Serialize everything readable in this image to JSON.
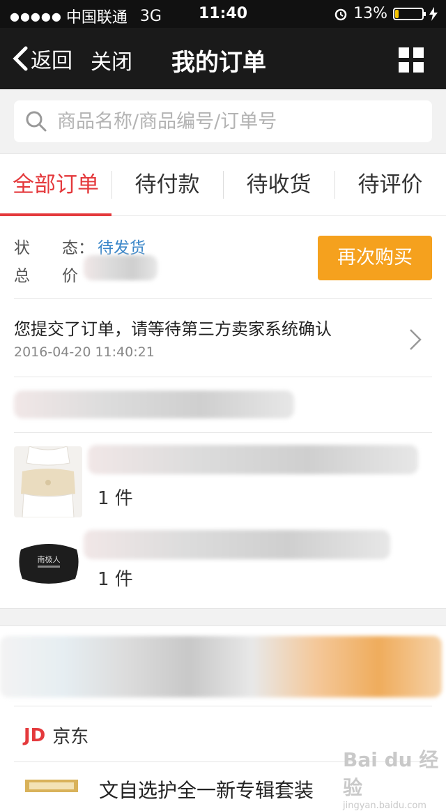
{
  "status_bar": {
    "carrier": "中国联通",
    "network": "3G",
    "time": "11:40",
    "battery_percent": "13%",
    "battery_level": 0.13,
    "battery_color": "#f5c400"
  },
  "nav": {
    "back_label": "返回",
    "close_label": "关闭",
    "title": "我的订单",
    "menu_icon": "grid-icon"
  },
  "search": {
    "placeholder": "商品名称/商品编号/订单号",
    "icon": "search-icon"
  },
  "tabs": [
    {
      "label": "全部订单",
      "active": true
    },
    {
      "label": "待付款",
      "active": false
    },
    {
      "label": "待收货",
      "active": false
    },
    {
      "label": "待评价",
      "active": false
    }
  ],
  "order": {
    "status_label": "状　　态：",
    "status_value": "待发货",
    "total_label": "总　　价",
    "rebuy_label": "再次购买",
    "tracking_message": "您提交了订单，请等待第三方卖家系统确认",
    "tracking_time": "2016-04-20 11:40:21",
    "items": [
      {
        "quantity": "1 件"
      },
      {
        "quantity": "1 件"
      }
    ]
  },
  "next_order": {
    "shop_logo": "JD",
    "shop_name": "京东",
    "product_title": "文自选护全一新专辑套装"
  },
  "watermark": {
    "text": "Bai du 经验",
    "url": "jingyan.baidu.com"
  },
  "colors": {
    "accent_red": "#e4393c",
    "button_orange": "#f5a11e",
    "status_blue": "#3a86c8"
  }
}
